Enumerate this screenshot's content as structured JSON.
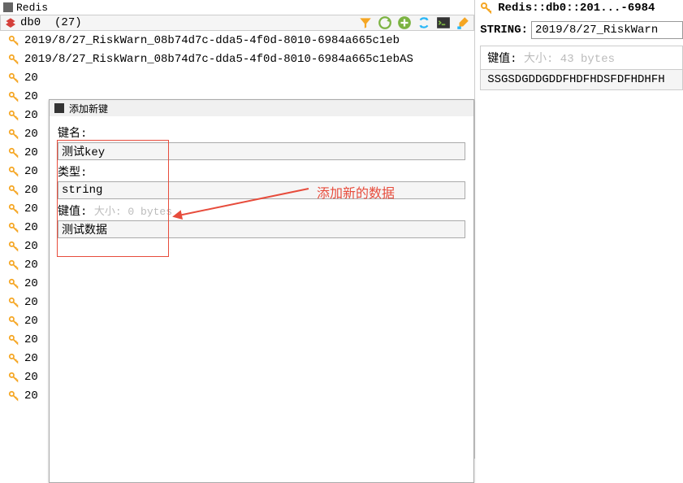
{
  "titlebar": {
    "text": "Redis"
  },
  "db": {
    "name": "db0",
    "count": "(27)"
  },
  "keys": [
    "2019/8/27_RiskWarn_08b74d7c-dda5-4f0d-8010-6984a665c1eb",
    "2019/8/27_RiskWarn_08b74d7c-dda5-4f0d-8010-6984a665c1ebAS",
    "20",
    "20",
    "20",
    "20",
    "20",
    "20",
    "20",
    "20",
    "20",
    "20",
    "20",
    "20",
    "20",
    "20",
    "20",
    "20",
    "20",
    "20"
  ],
  "dialog": {
    "title": "添加新键",
    "field1_label": "键名:",
    "field1_value": "测试key",
    "field2_label": "类型:",
    "field2_value": "string",
    "field3_label": "键值:",
    "field3_hint": "大小: 0 bytes",
    "field3_value": "测试数据"
  },
  "annotation": {
    "text": "添加新的数据"
  },
  "right": {
    "breadcrumb": "Redis::db0::201...-6984",
    "string_label": "STRING:",
    "string_value": "2019/8/27_RiskWarn",
    "value_label": "键值:",
    "value_hint": "大小: 43 bytes",
    "value_content": "SSGSDGDDGDDFHDFHDSFDFHDHFH"
  }
}
